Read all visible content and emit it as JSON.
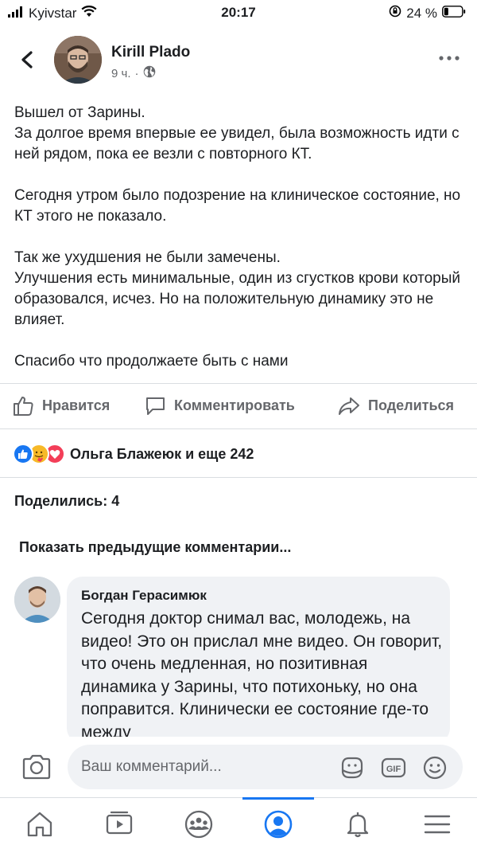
{
  "status_bar": {
    "carrier": "Kyivstar",
    "time": "20:17",
    "battery": "24 %",
    "battery_level": 0.24
  },
  "post": {
    "author": "Kirill Plado",
    "time": "9 ч.",
    "separator": "·",
    "paragraphs": [
      "Вышел от Зарины.\nЗа долгое время впервые ее увидел, была возможность идти с ней рядом, пока ее везли с повторного КТ.",
      "Сегодня утром было подозрение на клиническое состояние, но КТ этого не показало.",
      "Так же ухудшения не были замечены.\nУлучшения есть минимальные, один из сгустков крови который образовался, исчез. Но на положительную динамику это не влияет.",
      "Спасибо что продолжаете быть с нами"
    ]
  },
  "actions": {
    "like": "Нравится",
    "comment": "Комментировать",
    "share": "Поделиться"
  },
  "reactions": {
    "summary": "Ольга Блажеюк и еще 242",
    "icons": [
      "like-icon",
      "care-icon",
      "love-icon"
    ]
  },
  "shares": "Поделились: 4",
  "previous_comments": "Показать предыдущие комментарии...",
  "comment": {
    "author": "Богдан Герасимюк",
    "text": "Сегодня доктор снимал вас, молодежь, на видео! Это он прислал мне видео. Он говорит, что очень медленная, но позитивная динамика у Зарины, что потихоньку, но она поправится. Клинически ее состояние где-то между"
  },
  "composer": {
    "placeholder": "Ваш комментарий..."
  },
  "tabs": [
    "home-icon",
    "watch-icon",
    "groups-icon",
    "profile-icon",
    "notifications-icon",
    "menu-icon"
  ],
  "colors": {
    "accent": "#1877f2",
    "secondary_text": "#65676b",
    "bubble": "#f0f2f5"
  }
}
